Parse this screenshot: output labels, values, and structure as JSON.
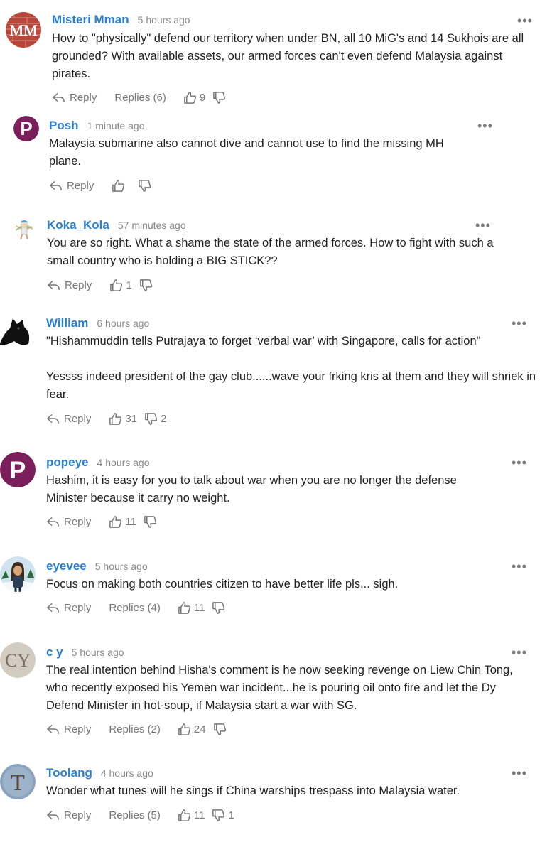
{
  "ui": {
    "reply_label": "Reply",
    "more_label": "•••"
  },
  "comments": [
    {
      "author": "Misteri Mman",
      "time": "5 hours ago",
      "text": "How to \"physically\" defend our territory when under BN, all 10 MiG's and 14 Sukhois are all grounded? With available assets, our armed forces can't even defend Malaysia against pirates.",
      "replies": "Replies (6)",
      "likes": "9",
      "dislikes": ""
    },
    {
      "author": "Posh",
      "time": "1 minute ago",
      "text": "Malaysia submarine also cannot dive and cannot use to find the missing MH plane.",
      "replies": "",
      "likes": "",
      "dislikes": ""
    },
    {
      "author": "Koka_Kola",
      "time": "57 minutes ago",
      "text": "You are so right. What a shame the state of the armed forces. How to fight with such a small country who is holding a BIG STICK??",
      "replies": "",
      "likes": "1",
      "dislikes": ""
    },
    {
      "author": "William",
      "time": "6 hours ago",
      "text": "\"Hishammuddin tells Putrajaya to forget ‘verbal war’ with Singapore, calls for action\"\n\nYessss indeed president of the gay club......wave your frking kris at them and they will shriek in fear.",
      "replies": "",
      "likes": "31",
      "dislikes": "2"
    },
    {
      "author": "popeye",
      "time": "4 hours ago",
      "text": "Hashim, it is easy for you to talk about war when you are no longer the defense Minister because it carry no weight.",
      "replies": "",
      "likes": "11",
      "dislikes": ""
    },
    {
      "author": "eyevee",
      "time": "5 hours ago",
      "text": "Focus on making both countries citizen to have better life pls... sigh.",
      "replies": "Replies (4)",
      "likes": "11",
      "dislikes": ""
    },
    {
      "author": "c y",
      "time": "5 hours ago",
      "text": "The real intention behind Hisha's comment is he now seeking revenge on Liew Chin Tong, who recently exposed his Yemen war incident...he is pouring oil onto fire and let the Dy Defend Minister in hot-soup, if Malaysia start a war with SG.",
      "replies": "Replies (2)",
      "likes": "24",
      "dislikes": ""
    },
    {
      "author": "Toolang",
      "time": "4 hours ago",
      "text": "Wonder what tunes will he sings if China warships trespass into Malaysia water.",
      "replies": "Replies (5)",
      "likes": "11",
      "dislikes": "1"
    }
  ],
  "avatars": [
    {
      "icon": "brick-wall-mm-avatar",
      "letters": "MM",
      "color": "#c0392b"
    },
    {
      "icon": "letter-p-avatar",
      "letters": "P",
      "color": "#7a1f5c"
    },
    {
      "icon": "cartoon-figure-avatar",
      "letters": "",
      "color": "#6fb3d9"
    },
    {
      "icon": "black-cat-avatar",
      "letters": "",
      "color": "#111111"
    },
    {
      "icon": "letter-p-avatar",
      "letters": "P",
      "color": "#7a1f5c"
    },
    {
      "icon": "cartoon-girl-avatar",
      "letters": "",
      "color": "#a8cbe0"
    },
    {
      "icon": "stone-cy-avatar",
      "letters": "CY",
      "color": "#c9c3b8"
    },
    {
      "icon": "stone-t-avatar",
      "letters": "T",
      "color": "#7f9bb8"
    }
  ]
}
